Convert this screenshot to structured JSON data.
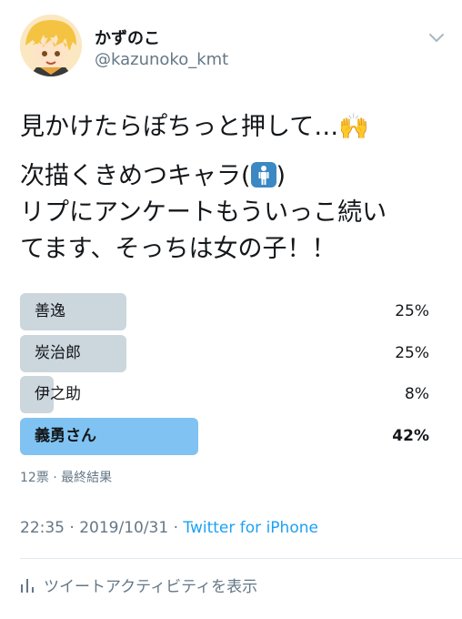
{
  "user": {
    "display_name": "かずのこ",
    "handle": "@kazunoko_kmt"
  },
  "tweet": {
    "line1": "見かけたらぽちっと押して…🙌",
    "line2a": "次描くきめつキャラ(",
    "line2b": ")",
    "line3": "リプにアンケートもういっこ続い",
    "line4": "てます、そっちは女の子！！"
  },
  "poll": {
    "options": [
      {
        "label": "善逸",
        "percent_text": "25%",
        "percent": 25
      },
      {
        "label": "炭治郎",
        "percent_text": "25%",
        "percent": 25
      },
      {
        "label": "伊之助",
        "percent_text": "8%",
        "percent": 8
      },
      {
        "label": "義勇さん",
        "percent_text": "42%",
        "percent": 42
      }
    ],
    "winner_index": 3,
    "meta": "12票 · 最終結果"
  },
  "footer": {
    "time_date": "22:35 · 2019/10/31 · ",
    "source": "Twitter for iPhone",
    "analytics_label": "ツイートアクティビティを表示"
  },
  "colors": {
    "accent": "#1da1f2",
    "winner_bar": "#80c3f2",
    "bar": "#ccd6dd",
    "secondary_text": "#657786"
  },
  "icons": {
    "chevron": "chevron-down-icon",
    "analytics": "bar-chart-icon",
    "emoji": "person-standing-emoji"
  }
}
